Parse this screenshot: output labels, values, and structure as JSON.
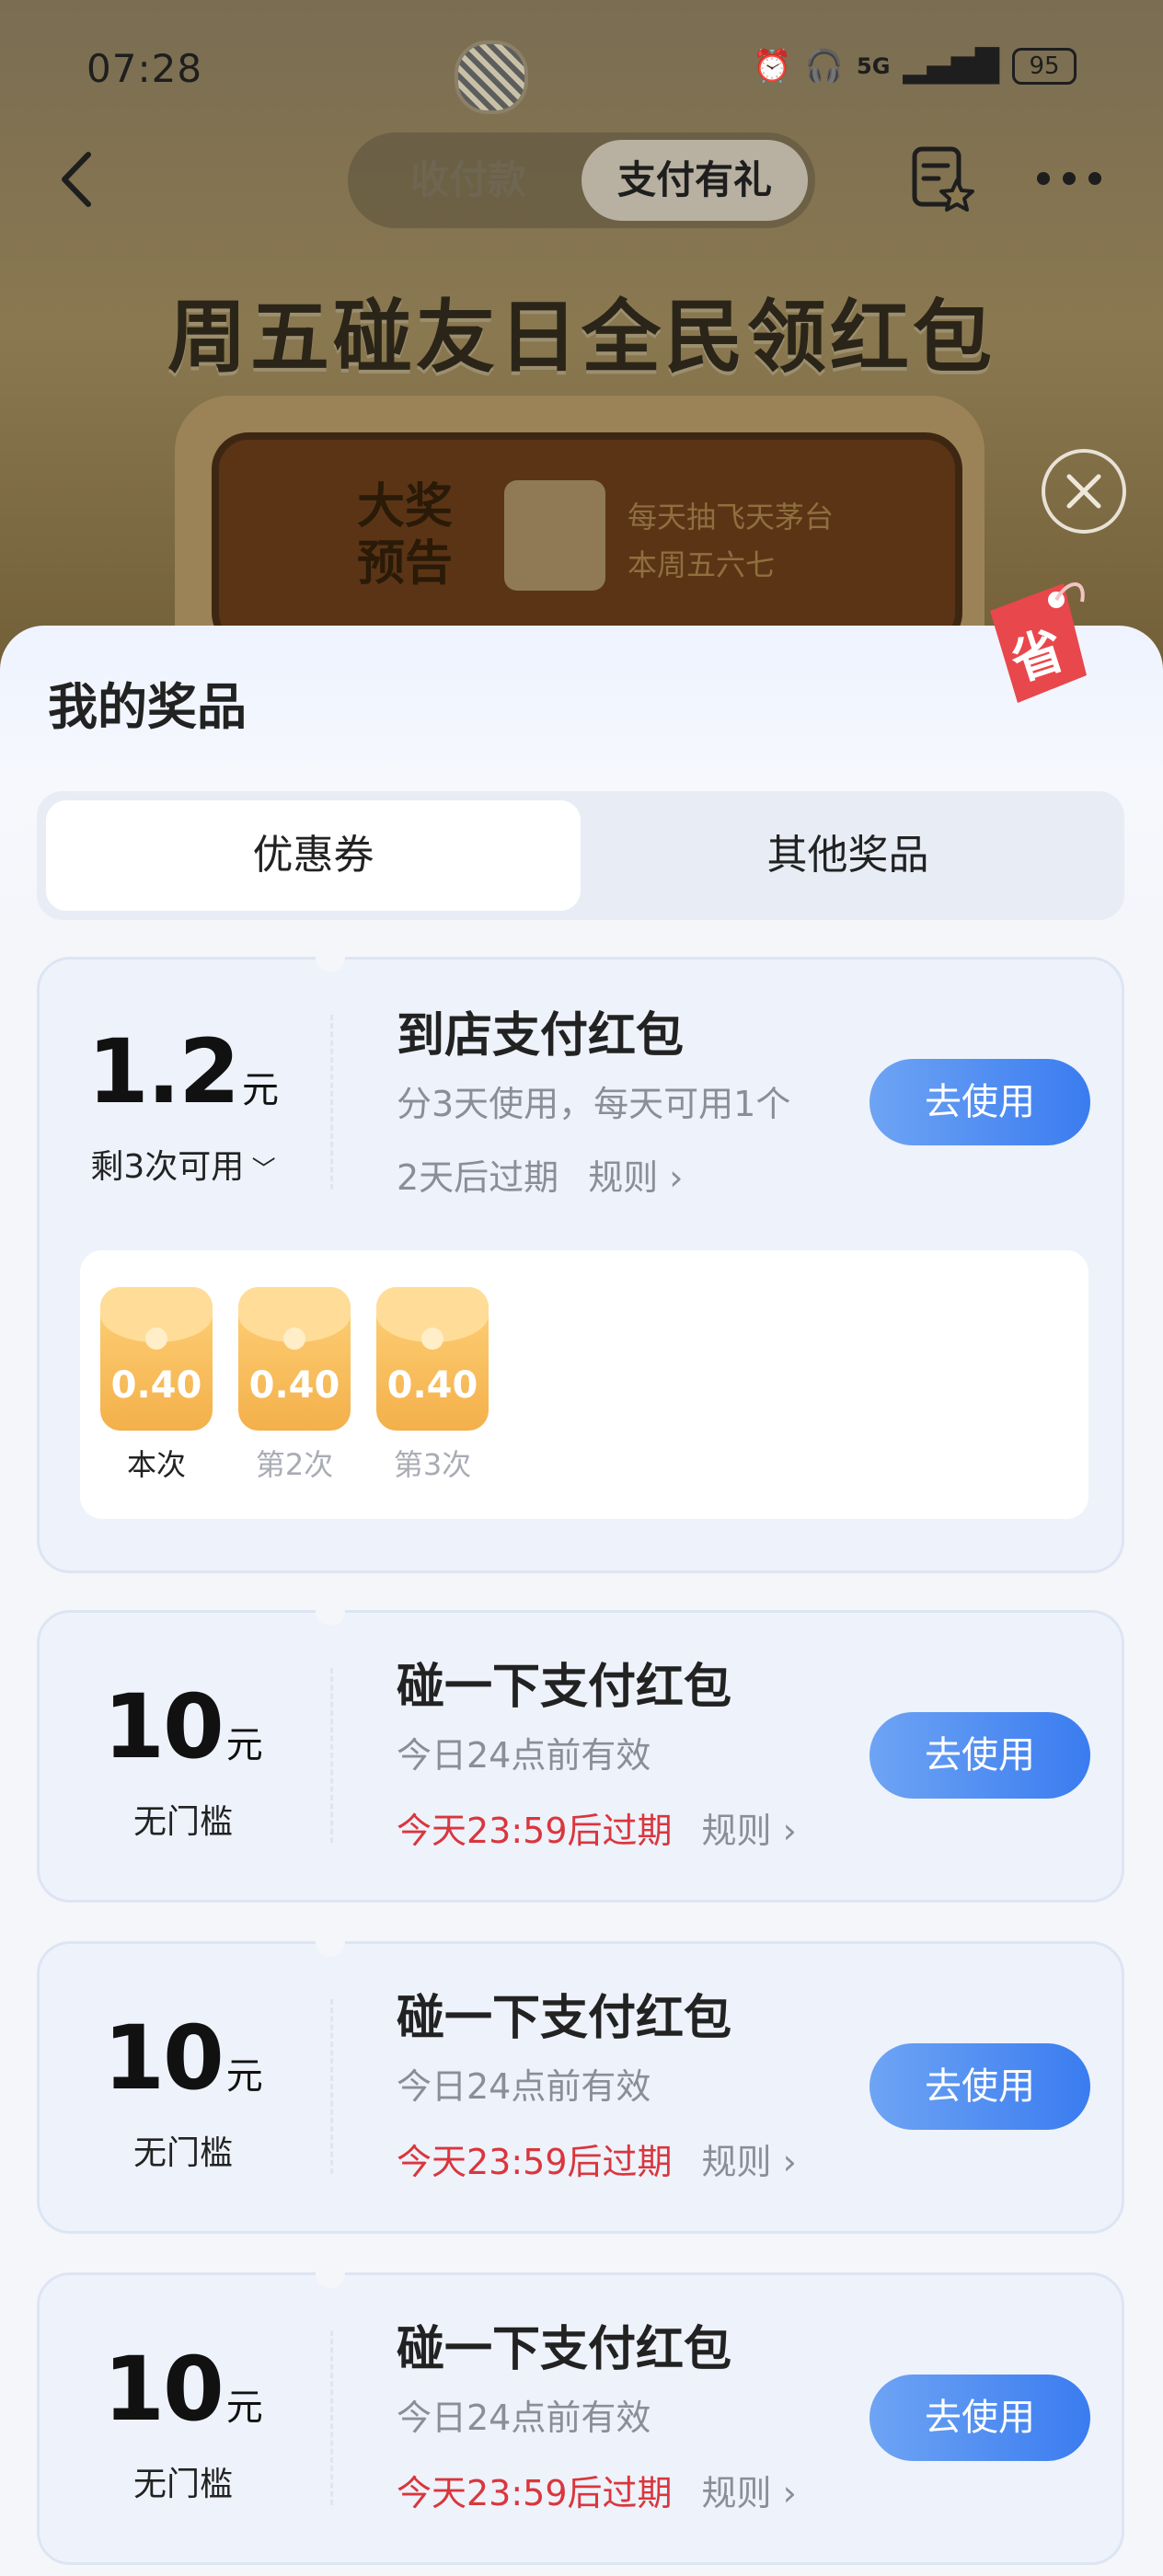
{
  "status_bar": {
    "time": "07:28",
    "network": "5G",
    "battery": "95"
  },
  "nav": {
    "tabs": [
      "收付款",
      "支付有礼"
    ],
    "active_tab": "支付有礼"
  },
  "banner": {
    "title": "周五碰友日全民领红包",
    "badge": "大奖预告",
    "line1": "每天抽飞天茅台",
    "line2": "本周五六七"
  },
  "sheet": {
    "title": "我的奖品",
    "tag": "省",
    "tabs": [
      "优惠券",
      "其他奖品"
    ],
    "active_tab": "优惠券"
  },
  "cards": [
    {
      "amount": "1.2",
      "unit": "元",
      "sub": "剩3次可用",
      "title": "到店支付红包",
      "desc": "分3天使用，每天可用1个",
      "expiry": "2天后过期",
      "rule": "规则",
      "button": "去使用",
      "packets": [
        {
          "value": "0.40",
          "label": "本次"
        },
        {
          "value": "0.40",
          "label": "第2次"
        },
        {
          "value": "0.40",
          "label": "第3次"
        }
      ]
    },
    {
      "amount": "10",
      "unit": "元",
      "sub": "无门槛",
      "title": "碰一下支付红包",
      "desc": "今日24点前有效",
      "expiry": "今天23:59后过期",
      "rule": "规则",
      "button": "去使用"
    },
    {
      "amount": "10",
      "unit": "元",
      "sub": "无门槛",
      "title": "碰一下支付红包",
      "desc": "今日24点前有效",
      "expiry": "今天23:59后过期",
      "rule": "规则",
      "button": "去使用"
    },
    {
      "amount": "10",
      "unit": "元",
      "sub": "无门槛",
      "title": "碰一下支付红包",
      "desc": "今日24点前有效",
      "expiry": "今天23:59后过期",
      "rule": "规则",
      "button": "去使用"
    }
  ],
  "colors": {
    "accent": "#3a7cf0",
    "expiry_red": "#d9363e",
    "packet": "#f3b04a"
  }
}
